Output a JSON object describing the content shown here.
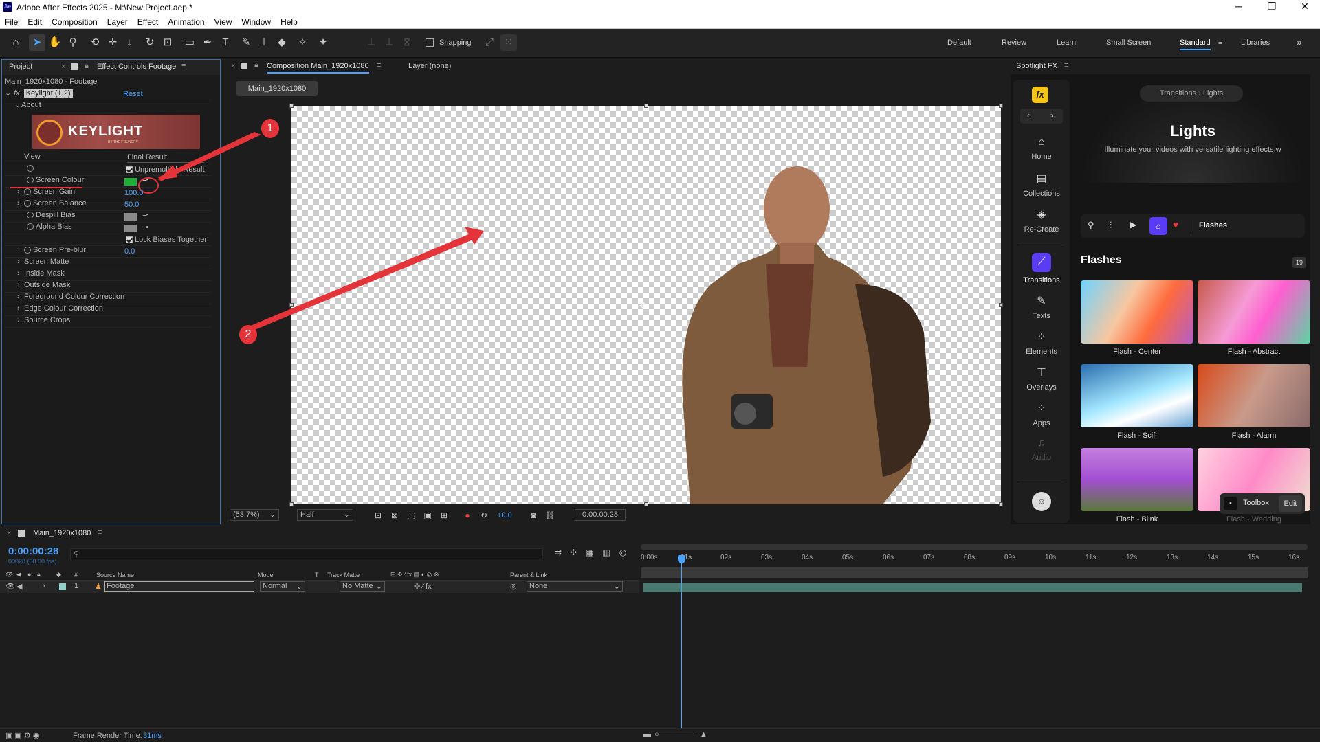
{
  "window": {
    "app_icon": "Ae",
    "title": "Adobe After Effects 2025 - M:\\New Project.aep *",
    "minimize": "─",
    "maximize": "❐",
    "close": "✕"
  },
  "menu": [
    "File",
    "Edit",
    "Composition",
    "Layer",
    "Effect",
    "Animation",
    "View",
    "Window",
    "Help"
  ],
  "toolbar": {
    "snapping": "Snapping",
    "workspaces": [
      "Default",
      "Review",
      "Learn",
      "Small Screen",
      "Standard",
      "Libraries"
    ],
    "more": "»"
  },
  "left_panel": {
    "tabs": {
      "project": "Project",
      "effect_controls": "Effect Controls Footage"
    },
    "layer_path": "Main_1920x1080 - Footage",
    "fx_label": "fx",
    "effect_name": "Keylight (1.2)",
    "reset": "Reset",
    "about": "About",
    "logo_text": "KEYLIGHT",
    "logo_sub": "BY THE FOUNDRY",
    "props": [
      {
        "name": "View",
        "value": "Final Result"
      },
      {
        "name": "Unpremultiply Result",
        "value": ""
      },
      {
        "name": "Screen Colour",
        "value": ""
      },
      {
        "name": "Screen Gain",
        "value": "100.0"
      },
      {
        "name": "Screen Balance",
        "value": "50.0"
      },
      {
        "name": "Despill Bias",
        "value": ""
      },
      {
        "name": "Alpha Bias",
        "value": ""
      },
      {
        "name": "Lock Biases Together",
        "value": ""
      },
      {
        "name": "Screen Pre-blur",
        "value": "0.0"
      },
      {
        "name": "Screen Matte",
        "value": ""
      },
      {
        "name": "Inside Mask",
        "value": ""
      },
      {
        "name": "Outside Mask",
        "value": ""
      },
      {
        "name": "Foreground Colour Correction",
        "value": ""
      },
      {
        "name": "Edge Colour Correction",
        "value": ""
      },
      {
        "name": "Source Crops",
        "value": ""
      }
    ],
    "screen_colour_hex": "#1fb03a"
  },
  "comp_panel": {
    "tab": "Composition Main_1920x1080",
    "layer_tab": "Layer (none)",
    "comp_button": "Main_1920x1080",
    "zoom": "(53.7%)",
    "resolution": "Half",
    "exposure": "+0.0",
    "timecode": "0:00:00:28"
  },
  "annotations": {
    "one": "1",
    "two": "2"
  },
  "spotlight": {
    "tab": "Spotlight FX",
    "crumb_a": "Transitions",
    "crumb_b": "Lights",
    "hero_title": "Lights",
    "hero_sub": "Illuminate your videos with versatile lighting effects.w",
    "nav": [
      {
        "label": "Home",
        "icon": "⌂"
      },
      {
        "label": "Collections",
        "icon": "▤"
      },
      {
        "label": "Re-Create",
        "icon": "◈"
      },
      {
        "label": "Transitions",
        "icon": "⟋"
      },
      {
        "label": "Texts",
        "icon": "✎"
      },
      {
        "label": "Elements",
        "icon": "⁘"
      },
      {
        "label": "Overlays",
        "icon": "⊤"
      },
      {
        "label": "Apps",
        "icon": "⁘"
      },
      {
        "label": "Audio",
        "icon": "♫"
      }
    ],
    "filter": "Flashes",
    "section": "Flashes",
    "count": "19",
    "items": [
      "Flash - Center",
      "Flash - Abstract",
      "Flash - Scifi",
      "Flash - Alarm",
      "Flash - Blink",
      "Flash - Wedding"
    ],
    "toolbox": "Toolbox",
    "edit": "Edit"
  },
  "timeline": {
    "tab": "Main_1920x1080",
    "timecode": "0:00:00:28",
    "frames": "00028 (30.00 fps)",
    "cols": {
      "num": "#",
      "source": "Source Name",
      "mode": "Mode",
      "t": "T",
      "matte": "Track Matte",
      "parent": "Parent & Link"
    },
    "layer": {
      "index": "1",
      "name": "Footage",
      "mode": "Normal",
      "matte": "No Matte",
      "parent": "None"
    },
    "ruler": [
      "0:00s",
      "01s",
      "02s",
      "03s",
      "04s",
      "05s",
      "06s",
      "07s",
      "08s",
      "09s",
      "10s",
      "11s",
      "12s",
      "13s",
      "14s",
      "15s",
      "16s"
    ],
    "render_label": "Frame Render Time:",
    "render_value": "31ms"
  }
}
